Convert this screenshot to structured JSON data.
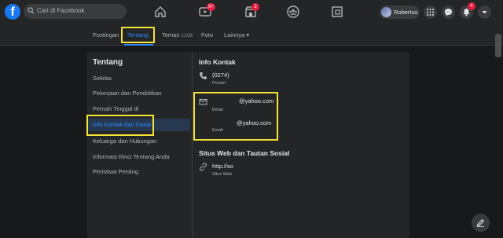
{
  "topbar": {
    "logo_letter": "f",
    "search_placeholder": "Cari di Facebook",
    "video_badge": "9+",
    "marketplace_badge": "2",
    "profile_name": "Robertus",
    "notif_badge": "4"
  },
  "tabs": [
    {
      "label": "Postingan"
    },
    {
      "label": "Tentang"
    },
    {
      "label": "Teman",
      "count": "1208"
    },
    {
      "label": "Foto"
    },
    {
      "label": "Lainnya ▾"
    }
  ],
  "about": {
    "title": "Tentang",
    "menu": [
      {
        "label": "Sekilas"
      },
      {
        "label": "Pekerjaan dan Pendidikan"
      },
      {
        "label": "Pernah Tinggal di"
      },
      {
        "label": "Info Kontak dan Dasar"
      },
      {
        "label": "Keluarga dan Hubungan"
      },
      {
        "label": "Informasi Rinci Tentang Anda"
      },
      {
        "label": "Peristiwa Penting"
      }
    ]
  },
  "contact": {
    "title": "Info Kontak",
    "phone": {
      "value": "(0274)",
      "label": "Ponsel"
    },
    "emails": [
      {
        "value": "@yahoo.com",
        "label": "Email"
      },
      {
        "value": "@yahoo.com",
        "label": "Email"
      }
    ]
  },
  "websites": {
    "title": "Situs Web dan Tautan Sosial",
    "site": {
      "value": "http://so",
      "label": "Situs Web"
    }
  },
  "colors": {
    "accent": "#2d88ff",
    "highlight": "#f5e33a",
    "badge": "#e41e3f"
  }
}
